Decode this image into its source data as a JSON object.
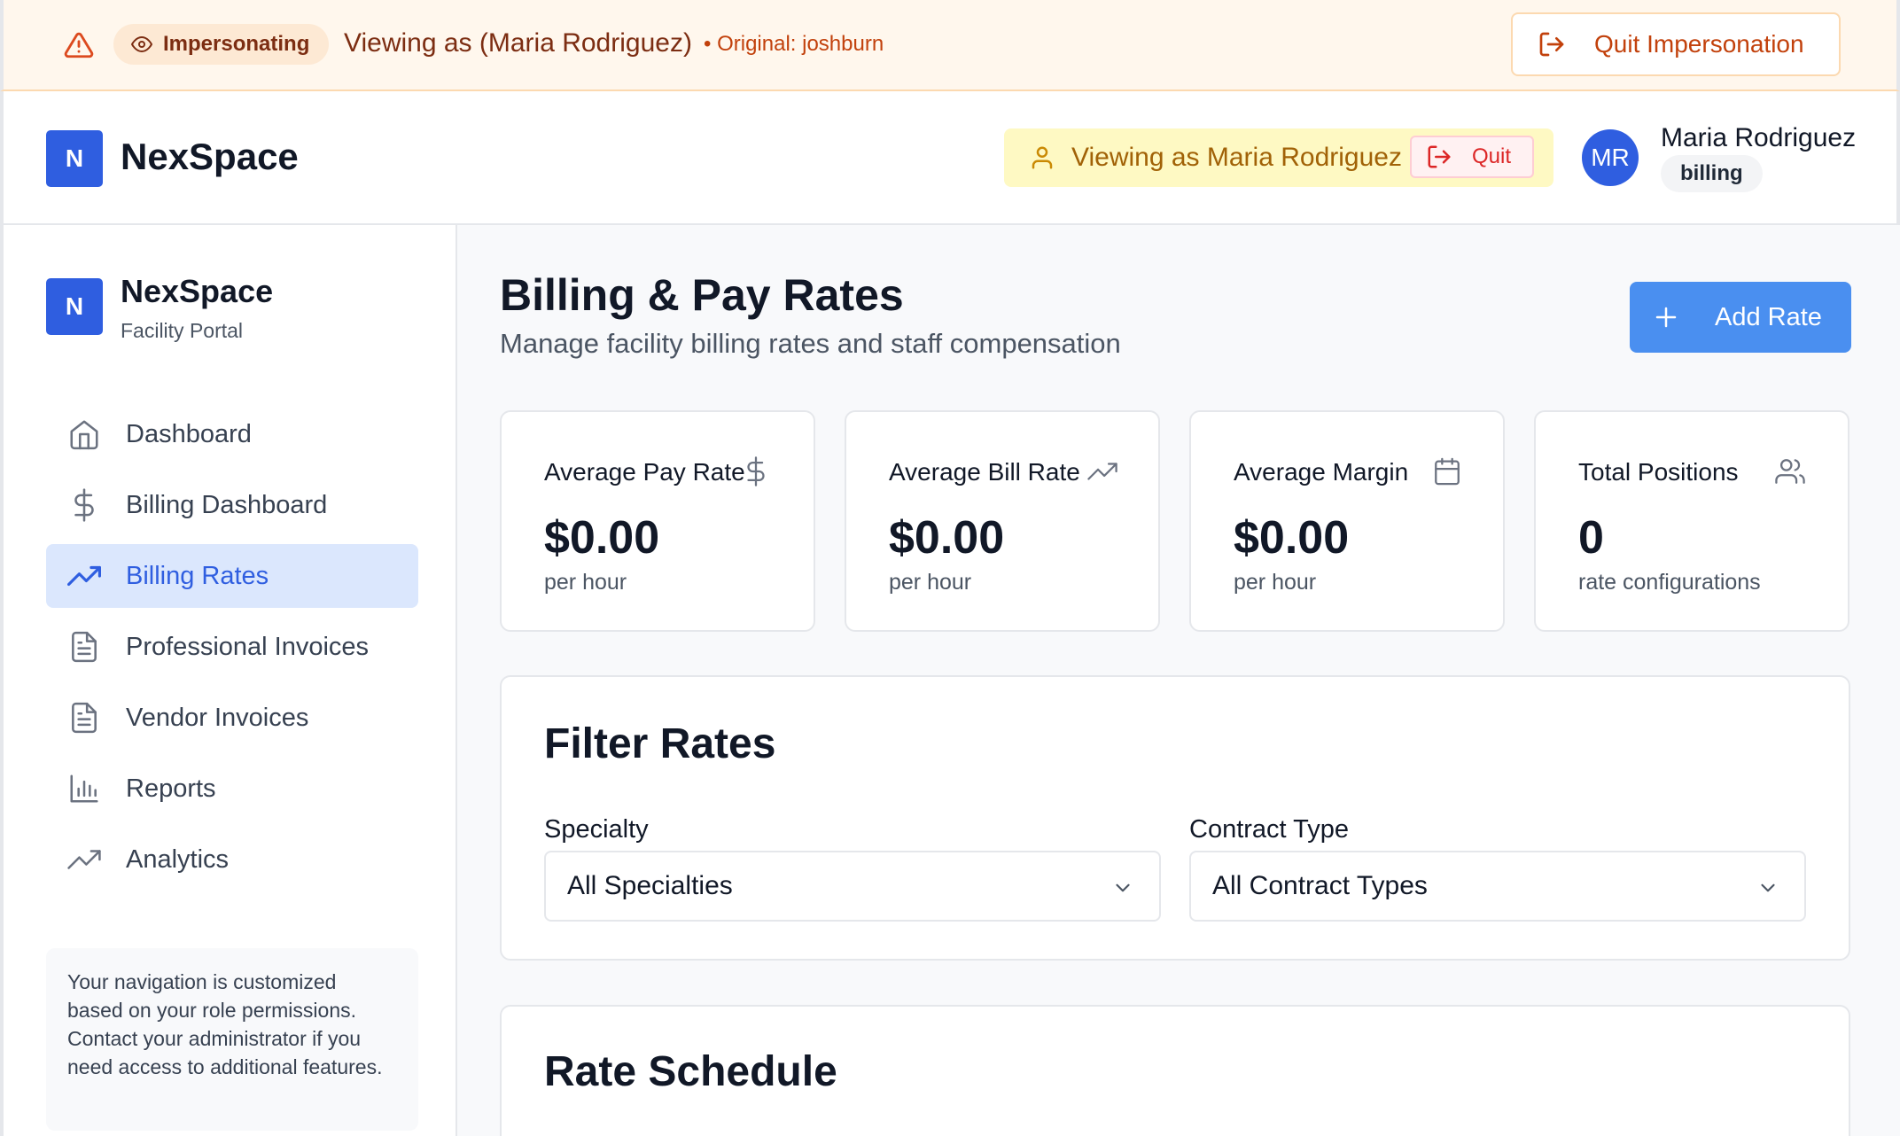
{
  "banner": {
    "badge": "Impersonating",
    "viewing": "Viewing as (Maria Rodriguez)",
    "original": "• Original: joshburn",
    "quit": "Quit Impersonation"
  },
  "header": {
    "logo_letter": "N",
    "brand": "NexSpace",
    "viewing": "Viewing as Maria Rodriguez",
    "quit": "Quit",
    "avatar": "MR",
    "user_name": "Maria Rodriguez",
    "role": "billing"
  },
  "sidebar": {
    "logo_letter": "N",
    "brand": "NexSpace",
    "subtitle": "Facility Portal",
    "items": [
      {
        "label": "Dashboard",
        "icon": "home-icon"
      },
      {
        "label": "Billing Dashboard",
        "icon": "dollar-icon"
      },
      {
        "label": "Billing Rates",
        "icon": "trending-up-icon",
        "active": true
      },
      {
        "label": "Professional Invoices",
        "icon": "file-text-icon"
      },
      {
        "label": "Vendor Invoices",
        "icon": "file-text-icon"
      },
      {
        "label": "Reports",
        "icon": "bar-chart-icon"
      },
      {
        "label": "Analytics",
        "icon": "trending-up-icon"
      }
    ],
    "note": "Your navigation is customized based on your role permissions. Contact your administrator if you need access to additional features."
  },
  "main": {
    "title": "Billing & Pay Rates",
    "subtitle": "Manage facility billing rates and staff compensation",
    "add_button": "Add Rate",
    "stats": [
      {
        "label": "Average Pay Rate",
        "value": "$0.00",
        "unit": "per hour",
        "icon": "dollar-icon"
      },
      {
        "label": "Average Bill Rate",
        "value": "$0.00",
        "unit": "per hour",
        "icon": "trending-up-icon"
      },
      {
        "label": "Average Margin",
        "value": "$0.00",
        "unit": "per hour",
        "icon": "calendar-icon"
      },
      {
        "label": "Total Positions",
        "value": "0",
        "unit": "rate configurations",
        "icon": "users-icon"
      }
    ],
    "filter": {
      "title": "Filter Rates",
      "specialty_label": "Specialty",
      "specialty_value": "All Specialties",
      "contract_label": "Contract Type",
      "contract_value": "All Contract Types"
    },
    "schedule_title": "Rate Schedule"
  },
  "colors": {
    "accent": "#2f5ee0",
    "button": "#4a8ff0",
    "banner_bg": "#fff7ed",
    "banner_text": "#c2410c",
    "active_nav_bg": "#dbe7fd"
  }
}
